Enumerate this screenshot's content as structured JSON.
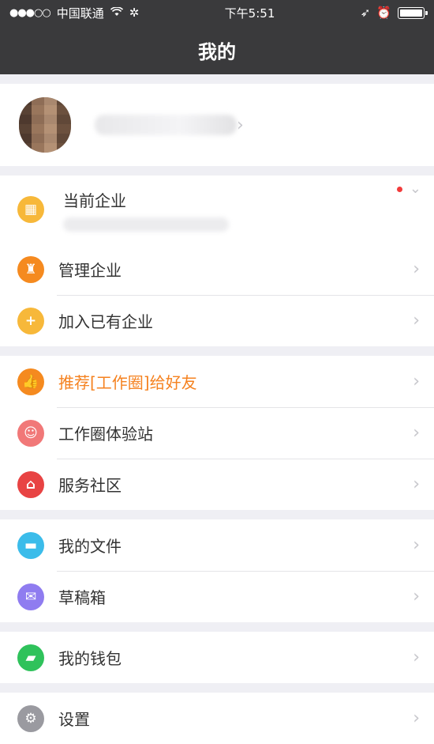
{
  "status": {
    "carrier": "中国联通",
    "time": "下午5:51"
  },
  "nav": {
    "title": "我的"
  },
  "company": {
    "label": "当前企业"
  },
  "groups": [
    [
      {
        "name": "manage-company",
        "label": "管理企业",
        "color": "#f58a1f",
        "glyph": "♜"
      },
      {
        "name": "join-company",
        "label": "加入已有企业",
        "color": "#f7b83a",
        "glyph": "+"
      }
    ],
    [
      {
        "name": "recommend-friends",
        "label": "推荐[工作圈]给好友",
        "color": "#f58a1f",
        "glyph": "👍",
        "orange": true
      },
      {
        "name": "experience-station",
        "label": "工作圈体验站",
        "color": "#f17878",
        "glyph": "☺"
      },
      {
        "name": "service-community",
        "label": "服务社区",
        "color": "#e84343",
        "glyph": "⌂"
      }
    ],
    [
      {
        "name": "my-files",
        "label": "我的文件",
        "color": "#3bbcea",
        "glyph": "▬"
      },
      {
        "name": "drafts",
        "label": "草稿箱",
        "color": "#8f7cf0",
        "glyph": "✉"
      }
    ],
    [
      {
        "name": "my-wallet",
        "label": "我的钱包",
        "color": "#2fc25b",
        "glyph": "▰"
      }
    ],
    [
      {
        "name": "settings",
        "label": "设置",
        "color": "#9a9aa0",
        "glyph": "⚙"
      }
    ]
  ]
}
